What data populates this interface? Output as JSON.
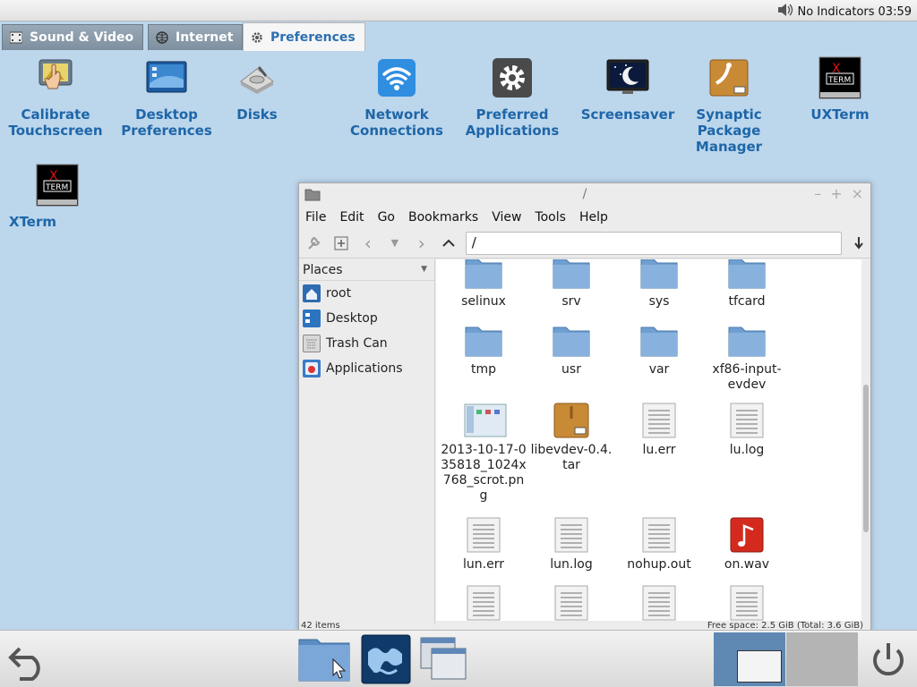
{
  "top_panel": {
    "indicator_text": "No Indicators",
    "clock": "03:59"
  },
  "tabs": [
    {
      "label": "Sound & Video"
    },
    {
      "label": "Internet"
    },
    {
      "label": "Preferences"
    }
  ],
  "launchers": [
    {
      "label": "Calibrate\nTouchscreen"
    },
    {
      "label": "Desktop\nPreferences"
    },
    {
      "label": "Disks"
    },
    {
      "label": "Network\nConnections"
    },
    {
      "label": "Preferred\nApplications"
    },
    {
      "label": "Screensaver"
    },
    {
      "label": "Synaptic\nPackage\nManager"
    },
    {
      "label": "UXTerm"
    },
    {
      "label": "XTerm"
    }
  ],
  "file_manager": {
    "title": "/",
    "menu": [
      "File",
      "Edit",
      "Go",
      "Bookmarks",
      "View",
      "Tools",
      "Help"
    ],
    "path": "/",
    "places_header": "Places",
    "places": [
      {
        "label": "root"
      },
      {
        "label": "Desktop"
      },
      {
        "label": "Trash Can"
      },
      {
        "label": "Applications"
      }
    ],
    "files": [
      {
        "name": "selinux",
        "type": "folder"
      },
      {
        "name": "srv",
        "type": "folder"
      },
      {
        "name": "sys",
        "type": "folder"
      },
      {
        "name": "tfcard",
        "type": "folder"
      },
      {
        "name": "tmp",
        "type": "folder"
      },
      {
        "name": "usr",
        "type": "folder"
      },
      {
        "name": "var",
        "type": "folder"
      },
      {
        "name": "xf86-input-\nevdev",
        "type": "folder"
      },
      {
        "name": "2013-10-17-0\n35818_1024x\n768_scrot.pn\ng",
        "type": "image"
      },
      {
        "name": "libevdev-0.4.\ntar",
        "type": "archive"
      },
      {
        "name": "lu.err",
        "type": "text"
      },
      {
        "name": "lu.log",
        "type": "text"
      },
      {
        "name": "lun.err",
        "type": "text"
      },
      {
        "name": "lun.log",
        "type": "text"
      },
      {
        "name": "nohup.out",
        "type": "text"
      },
      {
        "name": "on.wav",
        "type": "audio"
      },
      {
        "name": "",
        "type": "text"
      },
      {
        "name": "",
        "type": "text"
      },
      {
        "name": "",
        "type": "text"
      },
      {
        "name": "",
        "type": "text"
      }
    ],
    "status_left": "42 items",
    "status_right": "Free space: 2.5 GiB (Total: 3.6 GiB)"
  },
  "colors": {
    "desktop_bg": "#bcd6ec",
    "launcher_label": "#1e66a8",
    "active_tab_text": "#2d6fb0"
  }
}
